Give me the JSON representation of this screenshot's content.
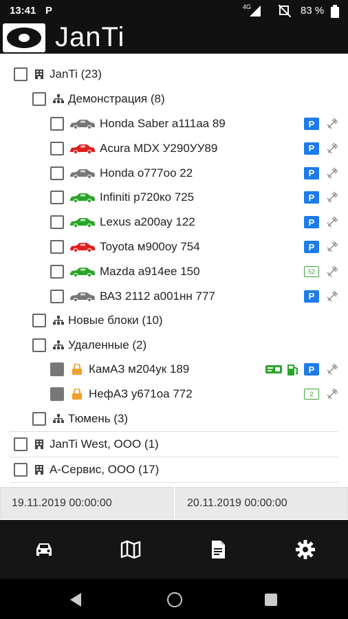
{
  "status_bar": {
    "time": "13:41",
    "notification": "P",
    "network": "4G",
    "battery": "83 %"
  },
  "app": {
    "brand": "JanTi"
  },
  "tree": {
    "group_janti": "JanTi (23)",
    "demo": "Демонстрация (8)",
    "cars": [
      {
        "label": "Honda Saber а111аа 89",
        "color": "#777777",
        "status": "P"
      },
      {
        "label": "Acura MDX У290УУ89",
        "color": "#e02020",
        "status": "P"
      },
      {
        "label": "Honda о777оо 22",
        "color": "#777777",
        "status": "P"
      },
      {
        "label": "Infiniti р720ко 725",
        "color": "#2aa52a",
        "status": "P"
      },
      {
        "label": "Lexus а200ау 122",
        "color": "#2aa52a",
        "status": "P"
      },
      {
        "label": "Toyota м900оу 754",
        "color": "#e02020",
        "status": "P"
      },
      {
        "label": "Mazda а914ее 150",
        "color": "#2aa52a",
        "status": "52"
      },
      {
        "label": "ВАЗ 2112 а001нн 777",
        "color": "#777777",
        "status": "P"
      }
    ],
    "new_blocks": "Новые блоки (10)",
    "deleted": "Удаленные (2)",
    "deleted_items": [
      {
        "label": "КамАЗ м204ук 189",
        "status": "P"
      },
      {
        "label": "НефАЗ у671оа 772",
        "status": "2"
      }
    ],
    "tyumen": "Тюмень (3)",
    "group_west": "JanTi West, ООО (1)",
    "group_aservice": "А-Сервис, ООО (17)"
  },
  "dates": {
    "from": "19.11.2019 00:00:00",
    "to": "20.11.2019 00:00:00"
  },
  "nav": {
    "icons": [
      "car-icon",
      "map-icon",
      "report-icon",
      "settings-icon"
    ]
  },
  "colors": {
    "accent": "#1e7ce8",
    "lock": "#f0a030",
    "online": "#2aa52a"
  }
}
